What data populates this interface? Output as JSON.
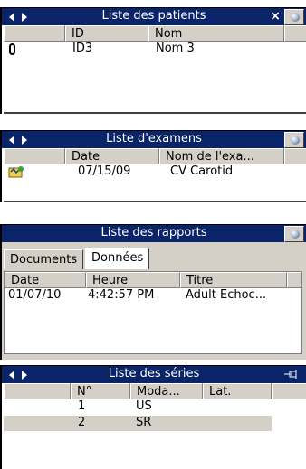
{
  "patients": {
    "title": "Liste des patients",
    "columns": [
      "ID",
      "Nom"
    ],
    "rows": [
      {
        "id": "ID3",
        "nom": "Nom 3"
      }
    ]
  },
  "exams": {
    "title": "Liste d'examens",
    "columns": [
      "Date",
      "Nom de l'exa..."
    ],
    "rows": [
      {
        "date": "07/15/09",
        "nom": "CV Carotid"
      }
    ]
  },
  "reports": {
    "title": "Liste des rapports",
    "tabs": [
      "Documents",
      "Données"
    ],
    "active_tab": "Données",
    "columns": [
      "Date",
      "Heure",
      "Titre"
    ],
    "rows": [
      {
        "date": "01/07/10",
        "heure": "4:42:57 PM",
        "titre": "Adult Echoc..."
      }
    ]
  },
  "series": {
    "title": "Liste des séries",
    "columns": [
      "N°",
      "Moda...",
      "Lat."
    ],
    "rows": [
      {
        "num": "1",
        "moda": "US"
      },
      {
        "num": "2",
        "moda": "SR"
      }
    ]
  },
  "icons": {
    "nav_prev": "triangle-left",
    "nav_next": "triangle-right",
    "close": "×",
    "pin": "pin-icon",
    "panel_menu": "globe-icon",
    "attachment": "paperclip-icon",
    "exam": "exam-icon"
  },
  "colors": {
    "titlebar": "#0a246a",
    "chrome": "#d4d0c8",
    "selection": "#d4d0c8"
  }
}
